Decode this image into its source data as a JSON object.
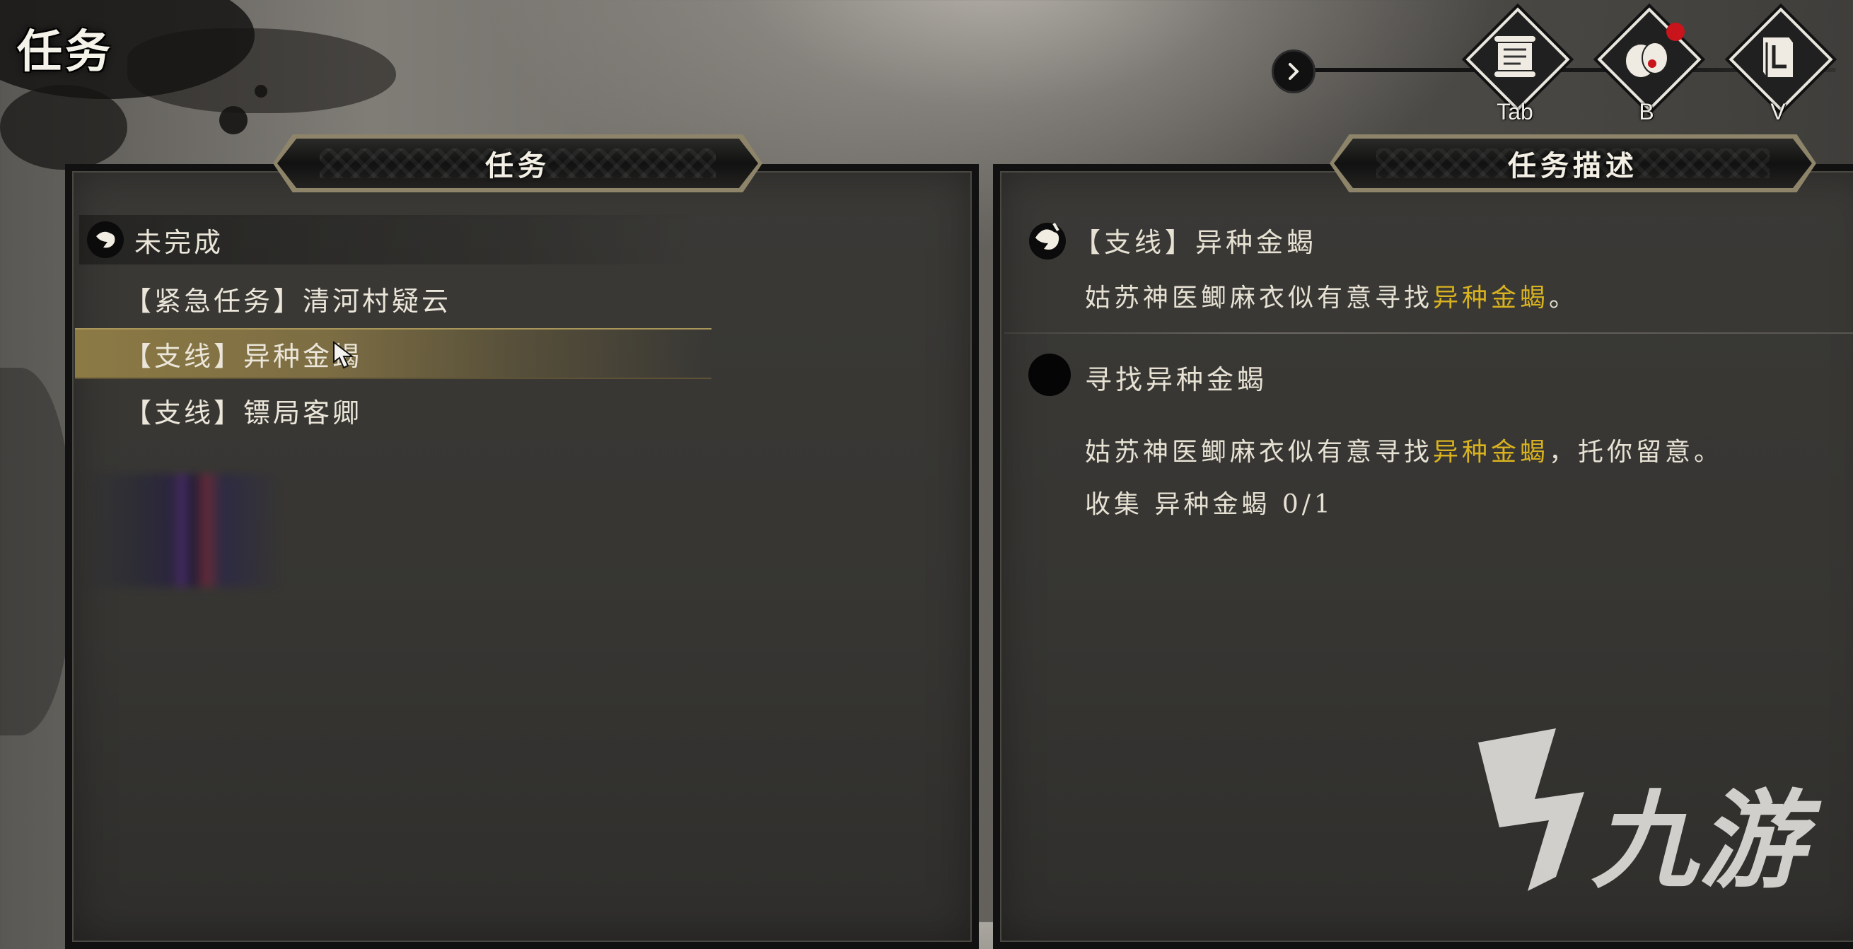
{
  "screen": {
    "title": "任务"
  },
  "toolbar": {
    "buttons": [
      {
        "icon": "quest-scroll-icon",
        "key": "Tab"
      },
      {
        "icon": "inventory-bag-icon",
        "key": "B",
        "notification": true
      },
      {
        "icon": "book-icon",
        "key": "V"
      }
    ]
  },
  "quest_list": {
    "header": "任务",
    "category": {
      "label": "未完成",
      "icon": "bird-ink-icon"
    },
    "items": [
      {
        "label": "【紧急任务】清河村疑云",
        "selected": false
      },
      {
        "label": "【支线】异种金蝎",
        "selected": true
      },
      {
        "label": "【支线】镖局客卿",
        "selected": false
      }
    ]
  },
  "quest_detail": {
    "header": "任务描述",
    "title": "【支线】异种金蝎",
    "intro_prefix": "姑苏神医鲫麻衣似有意寻找",
    "intro_highlight": "异种金蝎",
    "intro_suffix": "。",
    "objective": {
      "title": "寻找异种金蝎",
      "desc_prefix": "姑苏神医鲫麻衣似有意寻找",
      "desc_highlight": "异种金蝎",
      "desc_suffix": "，托你留意。",
      "progress": "收集 异种金蝎 0/1"
    }
  },
  "colors": {
    "highlight": "#d8b21f",
    "selected_row": "#8c7a45",
    "notification": "#c8141a"
  },
  "watermark": {
    "text": "九游"
  }
}
